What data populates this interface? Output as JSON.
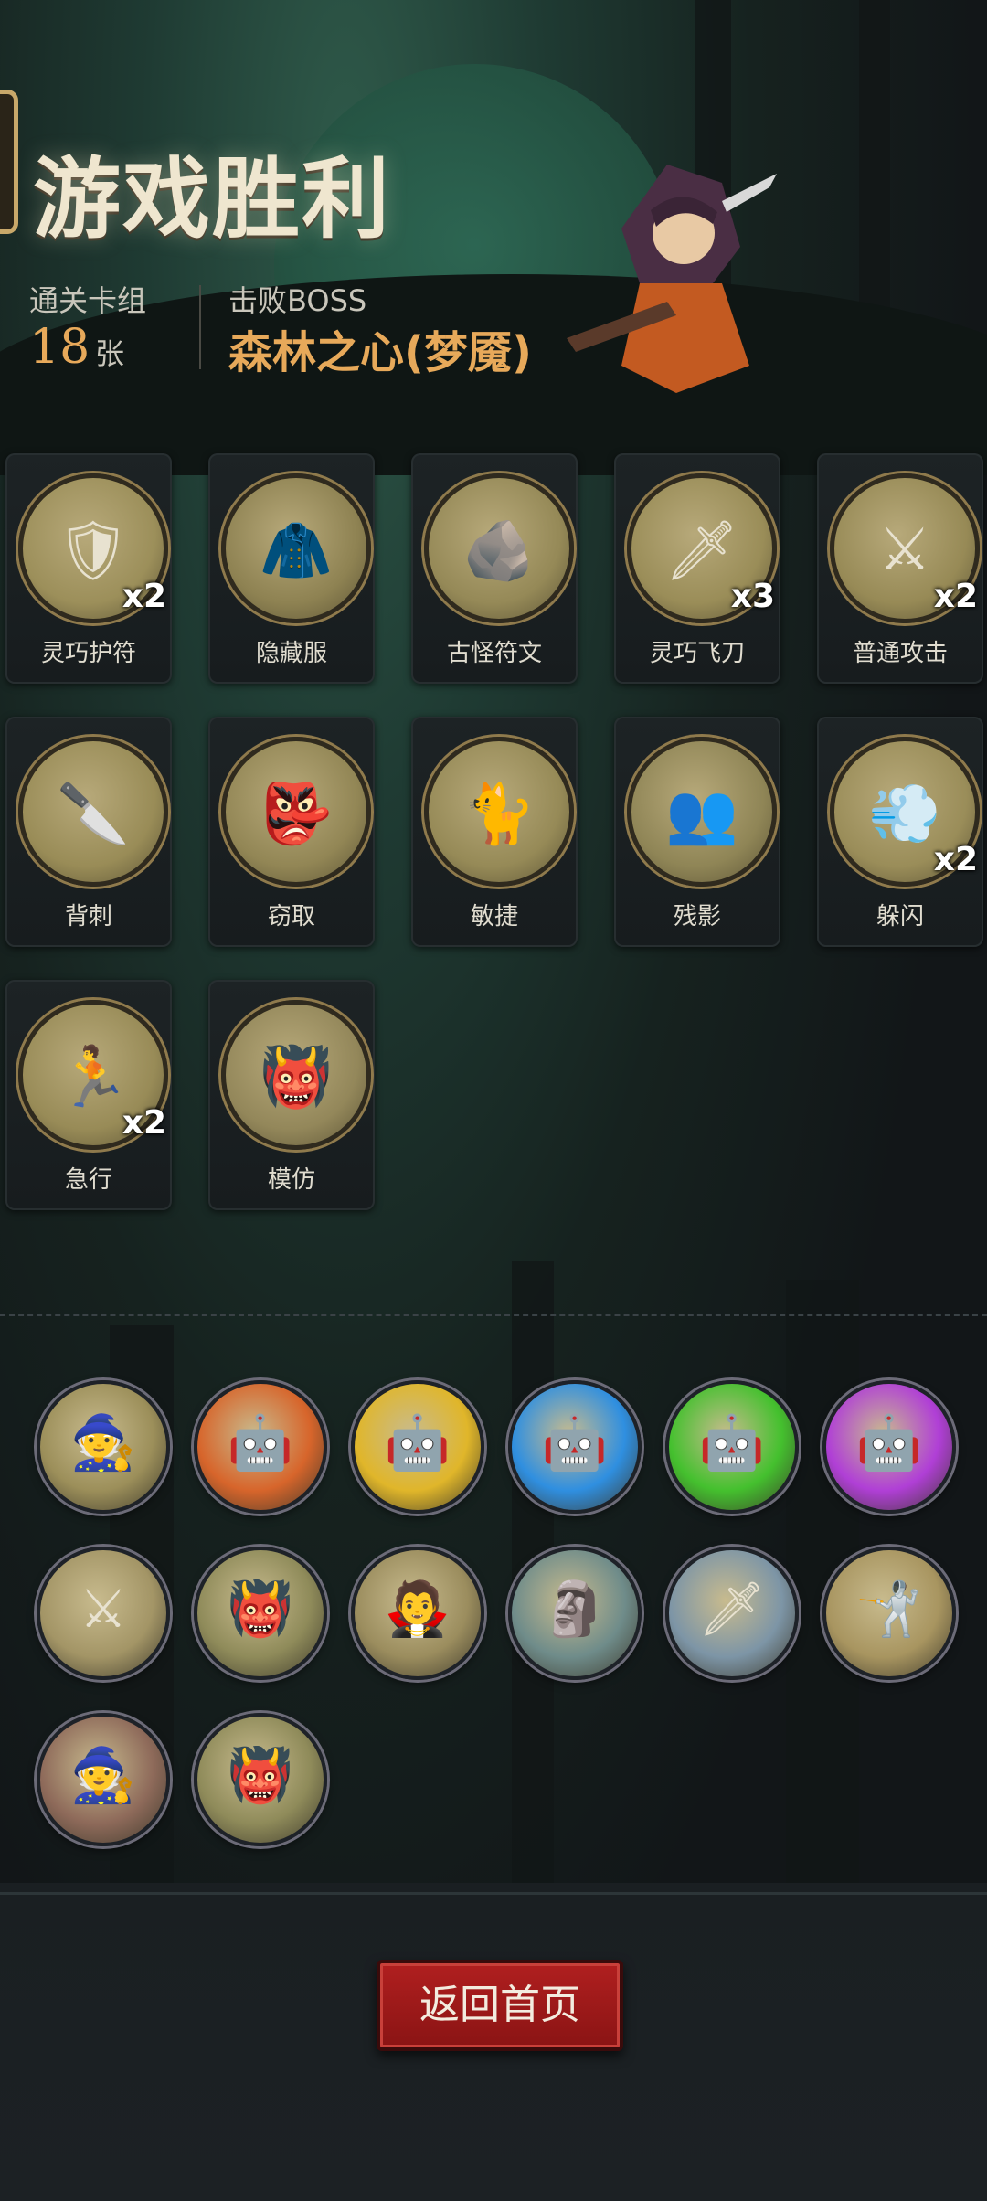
{
  "result": {
    "title": "游戏胜利",
    "deck_label": "通关卡组",
    "deck_count": "18",
    "deck_unit": "张",
    "boss_label": "击败BOSS",
    "boss_name": "森林之心(梦魇)"
  },
  "cards": [
    {
      "name": "灵巧护符",
      "count": "x2",
      "icon": "amulet-icon",
      "color": "#9c8f5a"
    },
    {
      "name": "隐藏服",
      "count": "",
      "icon": "hooded-cloak-icon",
      "color": "#8e8252"
    },
    {
      "name": "古怪符文",
      "count": "",
      "icon": "rune-stone-icon",
      "color": "#958957"
    },
    {
      "name": "灵巧飞刀",
      "count": "x3",
      "icon": "throwing-knife-icon",
      "color": "#9a8d58"
    },
    {
      "name": "普通攻击",
      "count": "x2",
      "icon": "strike-icon",
      "color": "#978a56"
    },
    {
      "name": "背刺",
      "count": "",
      "icon": "backstab-icon",
      "color": "#998c57"
    },
    {
      "name": "窃取",
      "count": "",
      "icon": "goblin-thief-icon",
      "color": "#928655"
    },
    {
      "name": "敏捷",
      "count": "",
      "icon": "panther-icon",
      "color": "#968a57"
    },
    {
      "name": "残影",
      "count": "",
      "icon": "afterimage-icon",
      "color": "#8f8556"
    },
    {
      "name": "躲闪",
      "count": "x2",
      "icon": "dodge-icon",
      "color": "#9a8d59"
    },
    {
      "name": "急行",
      "count": "x2",
      "icon": "dash-icon",
      "color": "#988b57"
    },
    {
      "name": "模仿",
      "count": "",
      "icon": "mimic-goblin-icon",
      "color": "#93875a"
    }
  ],
  "relics": [
    {
      "icon": "hooded-figure-icon",
      "color": "#9c8f5a"
    },
    {
      "icon": "robot-red-icon",
      "color": "#d7652b"
    },
    {
      "icon": "robot-yellow-icon",
      "color": "#e0b62a"
    },
    {
      "icon": "robot-blue-icon",
      "color": "#2f8fe0"
    },
    {
      "icon": "robot-green-icon",
      "color": "#44c02e"
    },
    {
      "icon": "robot-purple-icon",
      "color": "#b03fd6"
    },
    {
      "icon": "warrior-icon",
      "color": "#a39566"
    },
    {
      "icon": "ogre-icon",
      "color": "#8f8b5a"
    },
    {
      "icon": "vampire-icon",
      "color": "#9b8d5e"
    },
    {
      "icon": "golem-icon",
      "color": "#6f8c8a"
    },
    {
      "icon": "dagger-icon",
      "color": "#7d95a6"
    },
    {
      "icon": "hero-attack-icon",
      "color": "#a89560"
    },
    {
      "icon": "red-wizard-icon",
      "color": "#8e6a5a"
    },
    {
      "icon": "ogre-icon",
      "color": "#8f8b5a"
    }
  ],
  "home_button": "返回首页"
}
